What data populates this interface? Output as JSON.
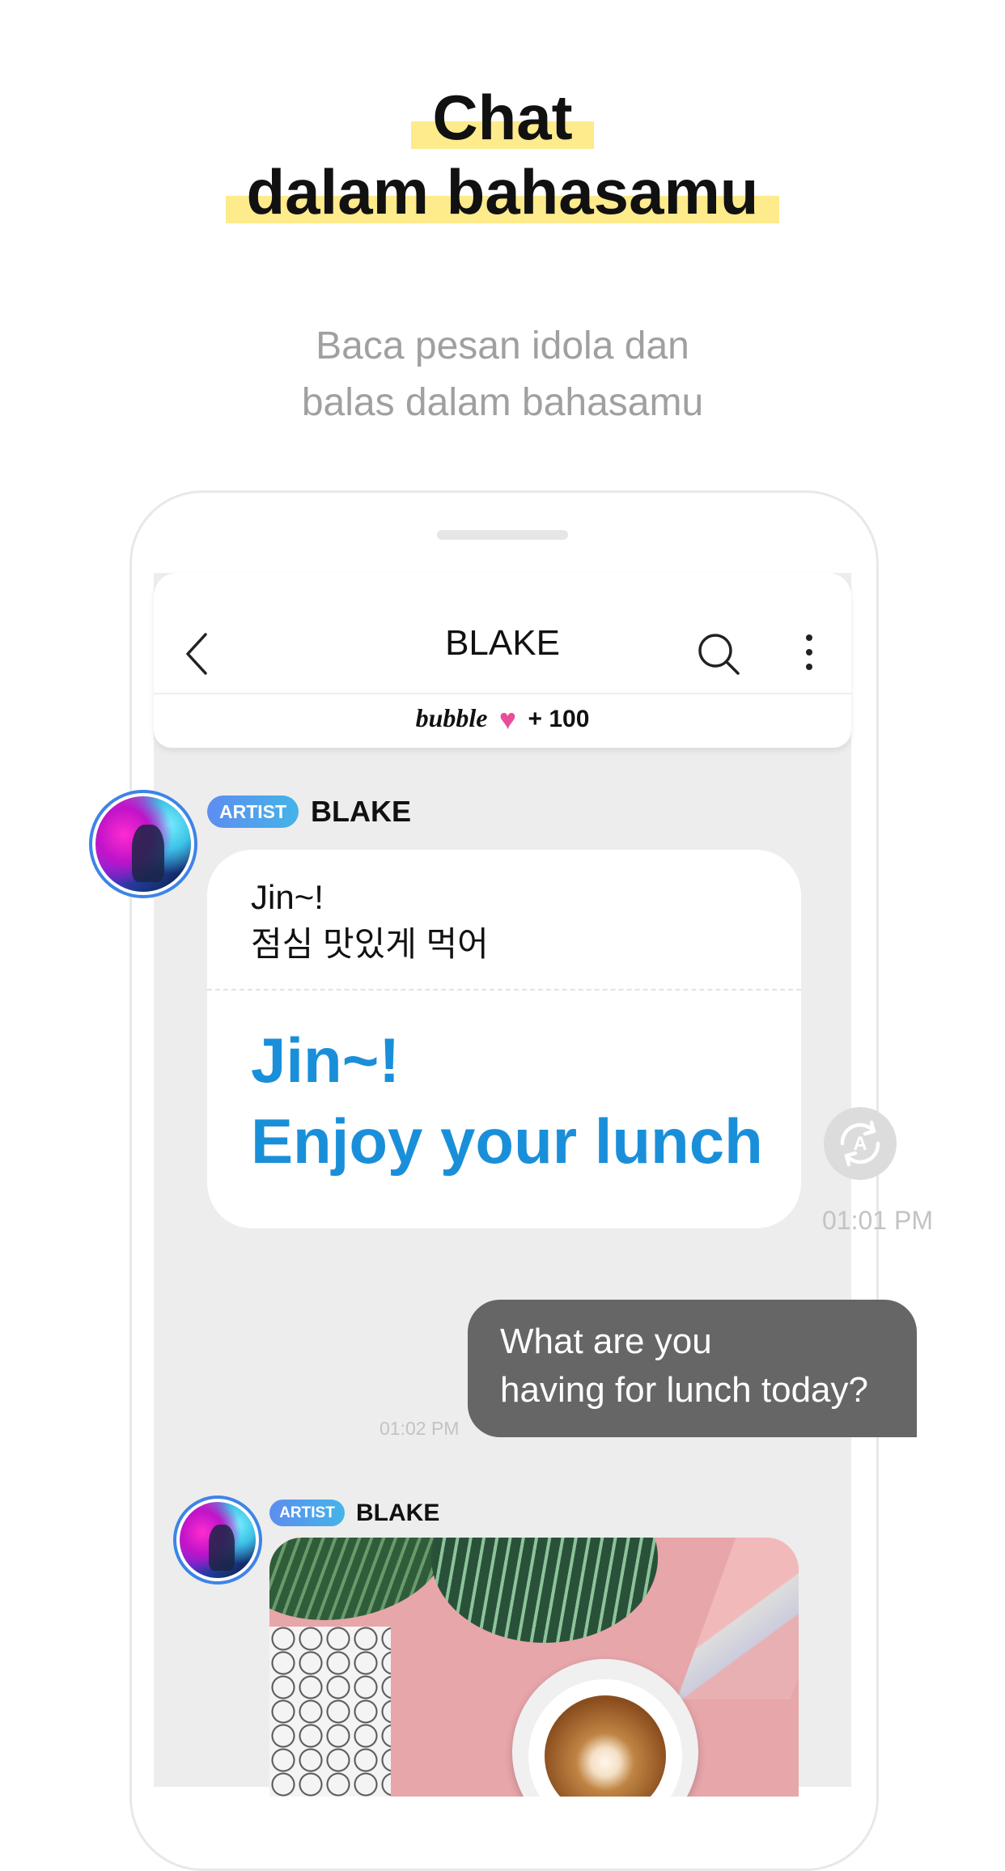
{
  "headline": {
    "line1": "Chat",
    "line2": "dalam bahasamu"
  },
  "subtitle": {
    "line1": "Baca pesan idola dan",
    "line2": "balas dalam bahasamu"
  },
  "chat_header": {
    "title": "BLAKE",
    "bubble_brand": "bubble",
    "bubble_points": "+ 100"
  },
  "messages": [
    {
      "badge": "ARTIST",
      "sender": "BLAKE",
      "original_line1": "Jin~!",
      "original_line2": "점심 맛있게 먹어",
      "translated_line1": "Jin~!",
      "translated_line2": "Enjoy your lunch",
      "time": "01:01 PM"
    },
    {
      "outgoing_line1": "What are you",
      "outgoing_line2": "having for lunch today?",
      "time": "01:02 PM"
    },
    {
      "badge": "ARTIST",
      "sender": "BLAKE"
    }
  ],
  "icons": [
    "back-icon",
    "search-icon",
    "more-icon",
    "heart-icon",
    "translate-icon"
  ],
  "colors": {
    "highlight": "#fdeb8c",
    "translation": "#1a8fd9",
    "outgoing_bubble": "#666666",
    "heart": "#e84f9b"
  }
}
